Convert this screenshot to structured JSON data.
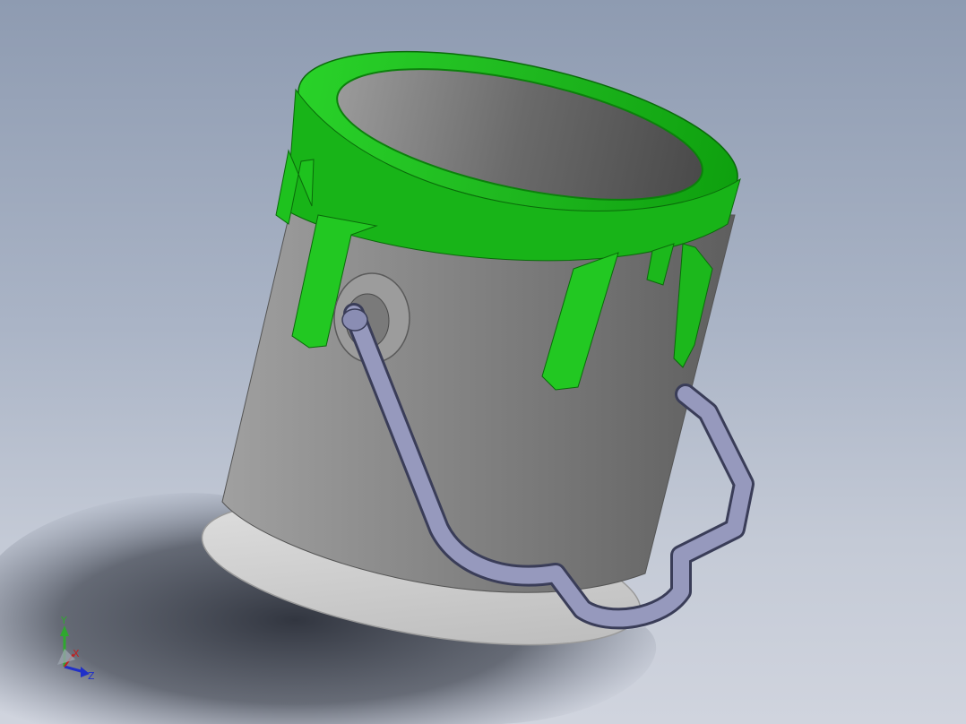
{
  "viewport": {
    "title": "",
    "background_top": "#8e9bb1",
    "background_bottom": "#d0d4de"
  },
  "model": {
    "name": "paint-bucket",
    "colors": {
      "can_body": "#7d7d7d",
      "can_rim": "#d4d4d4",
      "lid": "#1fbf1f",
      "lid_dark": "#0f8e0f",
      "handle": "#8f93b5",
      "shadow": "#3a3f4a"
    }
  },
  "triad": {
    "y_label": "Y",
    "x_label": "X",
    "z_label": "Z",
    "y_color": "#2fa82f",
    "x_color": "#c02020",
    "z_color": "#2030c8"
  }
}
